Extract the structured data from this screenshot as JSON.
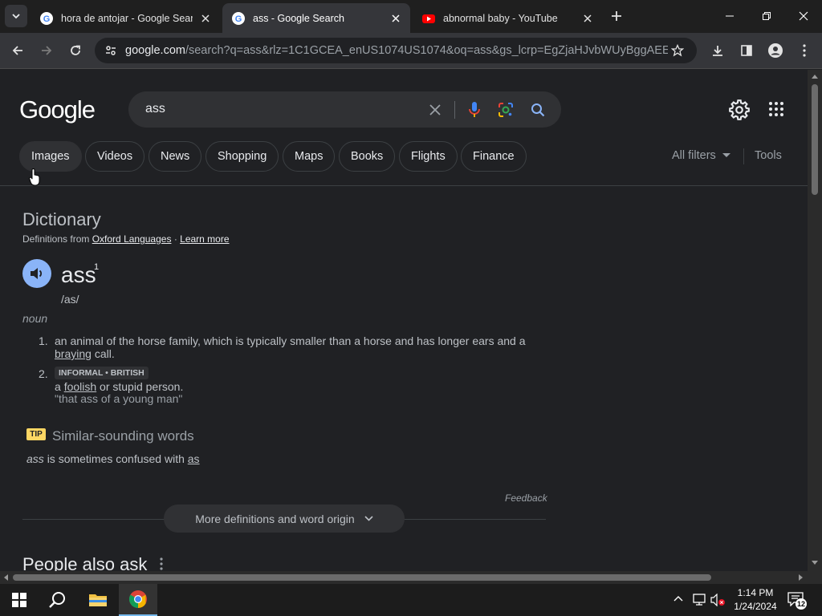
{
  "browser": {
    "tabs": [
      {
        "title": "hora de antojar - Google Search",
        "favicon": "google-icon",
        "active": false
      },
      {
        "title": "ass - Google Search",
        "favicon": "google-icon",
        "active": true
      },
      {
        "title": "abnormal baby - YouTube",
        "favicon": "youtube-icon",
        "active": false
      }
    ],
    "url_host": "google.com",
    "url_rest": "/search?q=ass&rlz=1C1GCEA_enUS1074US1074&oq=ass&gs_lcrp=EgZjaHJvbWUyBggAEEUYO..."
  },
  "search": {
    "logo": "Google",
    "query": "ass",
    "chips": [
      "Images",
      "Videos",
      "News",
      "Shopping",
      "Maps",
      "Books",
      "Flights",
      "Finance"
    ],
    "all_filters": "All filters",
    "tools": "Tools"
  },
  "dictionary": {
    "title": "Dictionary",
    "source_prefix": "Definitions from",
    "source": "Oxford Languages",
    "separator": "·",
    "learn_more": "Learn more",
    "word": "ass",
    "sup": "1",
    "phonetic": "/as/",
    "part_of_speech": "noun",
    "defs": [
      {
        "num": "1.",
        "text_a": "an animal of the horse family, which is typically smaller than a horse and has longer ears and a",
        "link": "braying",
        "text_b": "call."
      },
      {
        "num": "2.",
        "label": "INFORMAL • BRITISH",
        "text_a": "a",
        "link": "foolish",
        "text_b": "or stupid person.",
        "example": "\"that ass of a young man\""
      }
    ],
    "tip": "TIP",
    "similar_title": "Similar-sounding words",
    "similar_word": "ass",
    "similar_mid": "is sometimes confused with",
    "similar_link": "as",
    "feedback": "Feedback",
    "more": "More definitions and word origin",
    "paa": "People also ask"
  },
  "taskbar": {
    "time": "1:14 PM",
    "date": "1/24/2024",
    "notifications": "12"
  },
  "colors": {
    "accent_blue": "#8ab4f8",
    "tip_yellow": "#fdd663",
    "page_bg": "#202124"
  }
}
